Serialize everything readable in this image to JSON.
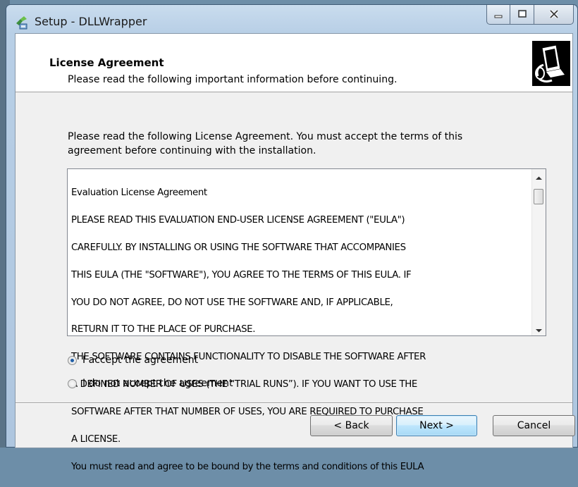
{
  "window": {
    "title": "Setup - DLLWrapper"
  },
  "header": {
    "title": "License Agreement",
    "subtitle": "Please read the following important information before continuing."
  },
  "intro": "Please read the following License Agreement. You must accept the terms of this agreement before continuing with the installation.",
  "license_lines": [
    "Evaluation License Agreement",
    "PLEASE READ THIS EVALUATION END-USER LICENSE AGREEMENT (\"EULA\")",
    "CAREFULLY.  BY INSTALLING OR USING THE SOFTWARE THAT ACCOMPANIES",
    "THIS EULA (THE \"SOFTWARE\"), YOU AGREE TO THE TERMS OF THIS EULA. IF",
    "YOU DO NOT AGREE, DO NOT USE THE SOFTWARE AND, IF APPLICABLE,",
    "RETURN IT TO THE PLACE OF PURCHASE.",
    "THE SOFTWARE CONTAINS FUNCTIONALITY TO DISABLE THE SOFTWARE AFTER",
    "A DEFINED NUMBER OF USES (THE “TRIAL RUNS”). IF YOU WANT TO USE THE",
    "SOFTWARE AFTER THAT NUMBER OF USES, YOU ARE REQUIRED TO PURCHASE",
    "A LICENSE.",
    "You must read and agree to be bound by the terms and conditions of this EULA"
  ],
  "options": {
    "accept": {
      "label": "I accept the agreement",
      "selected": true
    },
    "decline": {
      "label": "I do not accept the agreement",
      "selected": false
    }
  },
  "buttons": {
    "back": "< Back",
    "next": "Next >",
    "cancel": "Cancel"
  },
  "icons": {
    "app": "setup-app-icon",
    "header": "install-computer-icon",
    "minimize": "minimize-icon",
    "maximize": "maximize-icon",
    "close": "close-icon"
  },
  "colors": {
    "accent_radio": "#1f5ea6",
    "default_button_border": "#3c7fb1"
  }
}
